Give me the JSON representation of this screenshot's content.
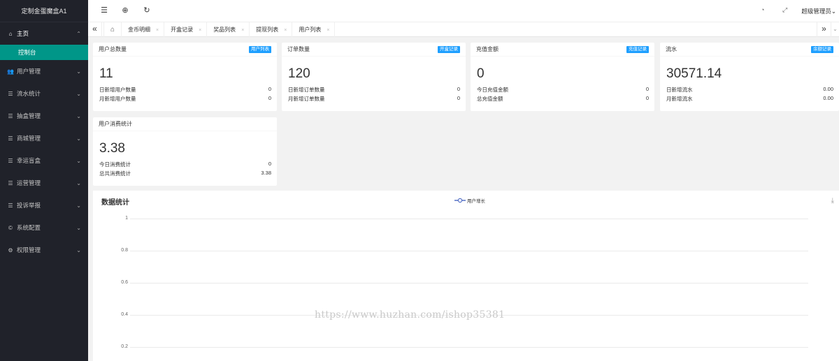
{
  "app": {
    "title": "定制金蛋魔盒A1"
  },
  "sidebar": {
    "items": [
      {
        "label": "主页",
        "icon": "home-icon",
        "glyph": "⌂",
        "open": true
      },
      {
        "label": "用户管理",
        "icon": "users-icon",
        "glyph": "👥"
      },
      {
        "label": "流水统计",
        "icon": "list-icon",
        "glyph": "☰"
      },
      {
        "label": "抽盒管理",
        "icon": "list-icon",
        "glyph": "☰"
      },
      {
        "label": "商城管理",
        "icon": "list-icon",
        "glyph": "☰"
      },
      {
        "label": "幸运盲盒",
        "icon": "list-icon",
        "glyph": "☰"
      },
      {
        "label": "运营管理",
        "icon": "list-icon",
        "glyph": "☰"
      },
      {
        "label": "投诉举报",
        "icon": "list-icon",
        "glyph": "☰"
      },
      {
        "label": "系统配置",
        "icon": "settings-icon",
        "glyph": "©"
      },
      {
        "label": "权限管理",
        "icon": "gear-icon",
        "glyph": "⚙"
      }
    ],
    "active_sub": "控制台"
  },
  "header": {
    "admin_label": "超级管理员"
  },
  "tabs": [
    {
      "label": "金币明细"
    },
    {
      "label": "开盒记录"
    },
    {
      "label": "奖品列表"
    },
    {
      "label": "提现列表"
    },
    {
      "label": "用户列表"
    }
  ],
  "cards": [
    {
      "title": "用户总数量",
      "badge": "用户列表",
      "value": "11",
      "rows": [
        {
          "label": "日新增用户数量",
          "value": "0"
        },
        {
          "label": "月新增用户数量",
          "value": "0"
        }
      ]
    },
    {
      "title": "订单数量",
      "badge": "开盒记录",
      "value": "120",
      "rows": [
        {
          "label": "日新增订单数量",
          "value": "0"
        },
        {
          "label": "月新增订单数量",
          "value": "0"
        }
      ]
    },
    {
      "title": "充值金额",
      "badge": "充值记录",
      "value": "0",
      "rows": [
        {
          "label": "今日充值金额",
          "value": "0"
        },
        {
          "label": "总充值金额",
          "value": "0"
        }
      ]
    },
    {
      "title": "流水",
      "badge": "余额记录",
      "value": "30571.14",
      "rows": [
        {
          "label": "日新增流水",
          "value": "0.00"
        },
        {
          "label": "月新增流水",
          "value": "0.00"
        }
      ]
    },
    {
      "title": "用户消费统计",
      "badge": "",
      "value": "3.38",
      "rows": [
        {
          "label": "今日消费统计",
          "value": "0"
        },
        {
          "label": "总共消费统计",
          "value": "3.38"
        }
      ]
    }
  ],
  "chart": {
    "title": "数据统计",
    "legend": "用户增长",
    "watermark": "https://www.huzhan.com/ishop35381"
  },
  "chart_data": {
    "type": "line",
    "title": "数据统计",
    "series": [
      {
        "name": "用户增长",
        "values": []
      }
    ],
    "yticks": [
      "1",
      "0.8",
      "0.6",
      "0.4",
      "0.2"
    ],
    "ylim": [
      0,
      1
    ],
    "grid": true,
    "legend_position": "top-center"
  },
  "colors": {
    "sidebar_bg": "#20222a",
    "active_green": "#009688",
    "badge_blue": "#1e9fff"
  }
}
